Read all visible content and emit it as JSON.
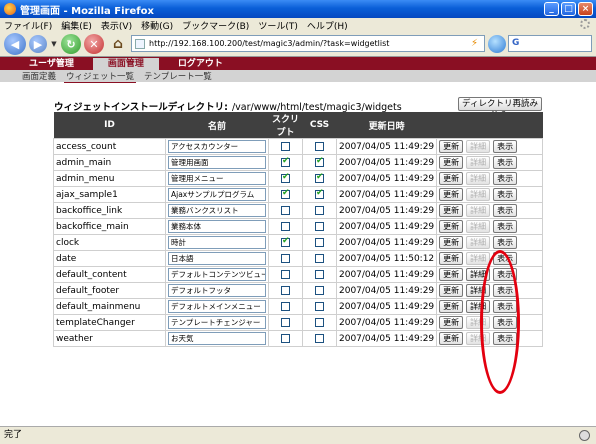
{
  "window": {
    "title": "管理画面 - Mozilla Firefox",
    "controls": {
      "minimize": "_",
      "maximize": "□",
      "close": "×"
    }
  },
  "menu": [
    "ファイル(F)",
    "編集(E)",
    "表示(V)",
    "移動(G)",
    "ブックマーク(B)",
    "ツール(T)",
    "ヘルプ(H)"
  ],
  "toolbar": {
    "url": "http://192.168.100.200/test/magic3/admin/?task=widgetlist",
    "search_value": "G"
  },
  "admin": {
    "tabs": [
      "ユーザ管理",
      "画面管理",
      "ログアウト"
    ],
    "active_tab": "画面管理",
    "subtabs": [
      "画面定義",
      "ウィジェット一覧",
      "テンプレート一覧"
    ],
    "active_subtab": "ウィジェット一覧"
  },
  "page": {
    "dir_label": "ウィジェットインストールディレクトリ:",
    "dir_path": "/var/www/html/test/magic3/widgets",
    "reload_button": "ディレクトリ再読み込み"
  },
  "table": {
    "headers": [
      "ID",
      "名前",
      "スクリプト",
      "CSS",
      "更新日時",
      ""
    ],
    "buttons": {
      "update": "更新",
      "detail": "詳細",
      "view": "表示"
    },
    "rows": [
      {
        "id": "access_count",
        "name": "アクセスカウンター",
        "script": false,
        "css": false,
        "updated": "2007/04/05 11:49:29",
        "detail_enabled": false
      },
      {
        "id": "admin_main",
        "name": "管理用画面",
        "script": true,
        "css": true,
        "updated": "2007/04/05 11:49:29",
        "detail_enabled": false
      },
      {
        "id": "admin_menu",
        "name": "管理用メニュー",
        "script": true,
        "css": true,
        "updated": "2007/04/05 11:49:29",
        "detail_enabled": false
      },
      {
        "id": "ajax_sample1",
        "name": "Ajaxサンプルプログラム",
        "script": true,
        "css": true,
        "updated": "2007/04/05 11:49:29",
        "detail_enabled": false
      },
      {
        "id": "backoffice_link",
        "name": "業務バンクスリスト",
        "script": false,
        "css": false,
        "updated": "2007/04/05 11:49:29",
        "detail_enabled": false
      },
      {
        "id": "backoffice_main",
        "name": "業務本体",
        "script": false,
        "css": false,
        "updated": "2007/04/05 11:49:29",
        "detail_enabled": false
      },
      {
        "id": "clock",
        "name": "時計",
        "script": true,
        "css": false,
        "updated": "2007/04/05 11:49:29",
        "detail_enabled": false
      },
      {
        "id": "date",
        "name": "日本語",
        "script": false,
        "css": false,
        "updated": "2007/04/05 11:50:12",
        "detail_enabled": false
      },
      {
        "id": "default_content",
        "name": "デフォルトコンテンツビュー",
        "script": false,
        "css": false,
        "updated": "2007/04/05 11:49:29",
        "detail_enabled": true
      },
      {
        "id": "default_footer",
        "name": "デフォルトフッタ",
        "script": false,
        "css": false,
        "updated": "2007/04/05 11:49:29",
        "detail_enabled": true
      },
      {
        "id": "default_mainmenu",
        "name": "デフォルトメインメニュー",
        "script": false,
        "css": false,
        "updated": "2007/04/05 11:49:29",
        "detail_enabled": true
      },
      {
        "id": "templateChanger",
        "name": "テンプレートチェンジャー",
        "script": false,
        "css": false,
        "updated": "2007/04/05 11:49:29",
        "detail_enabled": false
      },
      {
        "id": "weather",
        "name": "お天気",
        "script": false,
        "css": false,
        "updated": "2007/04/05 11:49:29",
        "detail_enabled": false
      }
    ]
  },
  "status": {
    "text": "完了"
  },
  "colors": {
    "admin_bar": "#8a0f23",
    "table_header": "#404040",
    "highlight_ellipse": "#e3000f"
  }
}
